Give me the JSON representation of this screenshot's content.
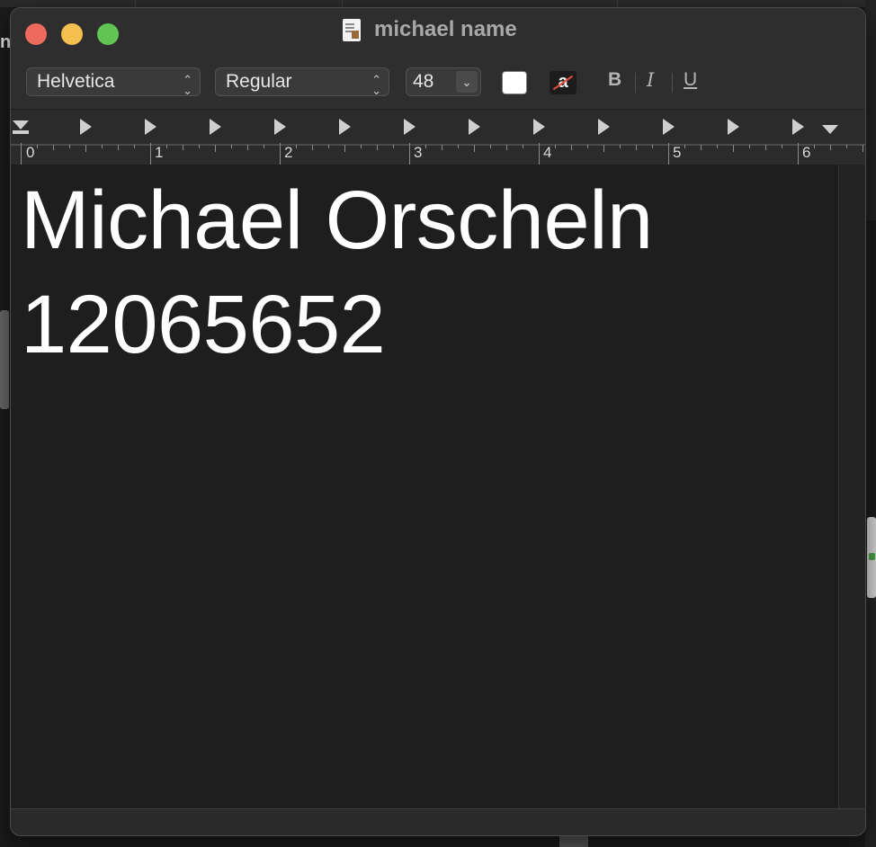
{
  "window": {
    "title": "michael name",
    "document_icon": "text-document-icon"
  },
  "toolbar": {
    "font_family": "Helvetica",
    "font_style": "Regular",
    "font_size": "48",
    "text_color": "#ffffff",
    "bold_label": "B",
    "italic_label": "I",
    "underline_label": "U",
    "bg_color_glyph": "a"
  },
  "ruler": {
    "numbers": [
      "0",
      "1",
      "2",
      "3",
      "4",
      "5",
      "6"
    ]
  },
  "document": {
    "lines": [
      "Michael Orscheln",
      "12065652"
    ]
  },
  "background": {
    "partial_letter": "n"
  },
  "colors": {
    "close": "#ed6a5e",
    "minimize": "#f5bf4f",
    "zoom": "#61c554"
  }
}
